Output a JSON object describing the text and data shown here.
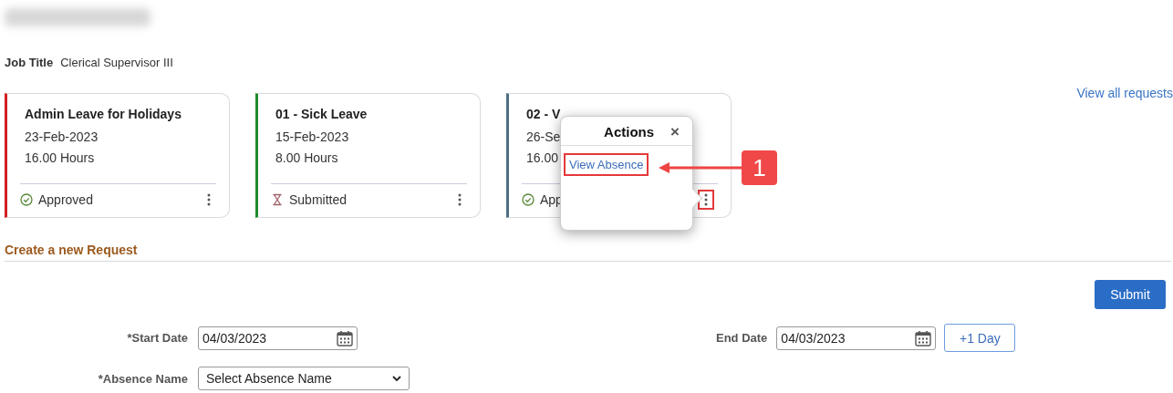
{
  "job_title": {
    "label": "Job Title",
    "value": "Clerical Supervisor III"
  },
  "view_all_link": "View all requests",
  "cards": [
    {
      "title": "Admin Leave for Holidays",
      "date": "23-Feb-2023",
      "hours": "16.00 Hours",
      "status": "Approved",
      "kind": "approved",
      "color": "#d0201f",
      "menu_highlighted": false
    },
    {
      "title": "01 - Sick Leave",
      "date": "15-Feb-2023",
      "hours": "8.00 Hours",
      "status": "Submitted",
      "kind": "submitted",
      "color": "#1f8a2a",
      "menu_highlighted": false
    },
    {
      "title": "02 - V",
      "date": "26-Se",
      "hours": "16.00",
      "status": "App",
      "kind": "approved",
      "color": "#4d6e80",
      "menu_highlighted": true
    }
  ],
  "actions_popup": {
    "title": "Actions",
    "close": "×",
    "items": [
      {
        "label": "View Absence",
        "highlighted": true
      }
    ]
  },
  "callout": {
    "number": "1"
  },
  "section_title": "Create a new Request",
  "submit": "Submit",
  "form": {
    "start_date": {
      "label": "*Start Date",
      "value": "04/03/2023"
    },
    "end_date": {
      "label": "End Date",
      "value": "04/03/2023"
    },
    "plus_day": "+1 Day",
    "absence_name": {
      "label": "*Absence Name",
      "value": "Select Absence Name"
    }
  }
}
